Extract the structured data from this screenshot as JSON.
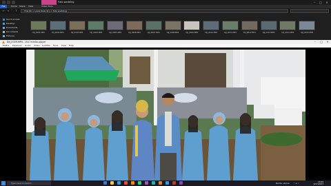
{
  "explorer": {
    "window_title": "Foto wedding",
    "ribbon_tabs": [
      "File",
      "Home",
      "Share",
      "View",
      "Video Tools"
    ],
    "address": "This PC  >  Local Disk (D:)  >  Foto wedding",
    "search_placeholder": "",
    "nav_items": [
      "Quick access",
      "Desktop",
      "Downloads",
      "Documents",
      "Pictures"
    ],
    "file_names": [
      "DJI_0001.MP4",
      "DJI_0002.MP4",
      "DJI_0003.MP4",
      "DJI_0004.MP4",
      "DJI_0005.MP4",
      "DJI_0006.MP4",
      "DJI_0007.MP4",
      "DJI_0008.MP4",
      "DJI_0009.MP4",
      "DJI_0010.MP4",
      "DJI_0011.MP4",
      "DJI_0012.MP4",
      "DJI_0013.MP4",
      "DJI_0014.MP4",
      "DJI_0015.MP4"
    ]
  },
  "media": {
    "title": "DJI_0009.MP4 - VLC media player",
    "menu": [
      "Media",
      "Playback",
      "Audio",
      "Video",
      "Subtitle",
      "Tools",
      "View",
      "Help"
    ]
  },
  "taskbar": {
    "search_placeholder": "Type here to search",
    "weather": "Berita utama",
    "time": "10:49",
    "date": "4/27/2023"
  },
  "colors": {
    "accent": "#1f5fbf",
    "media_accent": "#f08a00",
    "dress": "#5f9fd0"
  }
}
